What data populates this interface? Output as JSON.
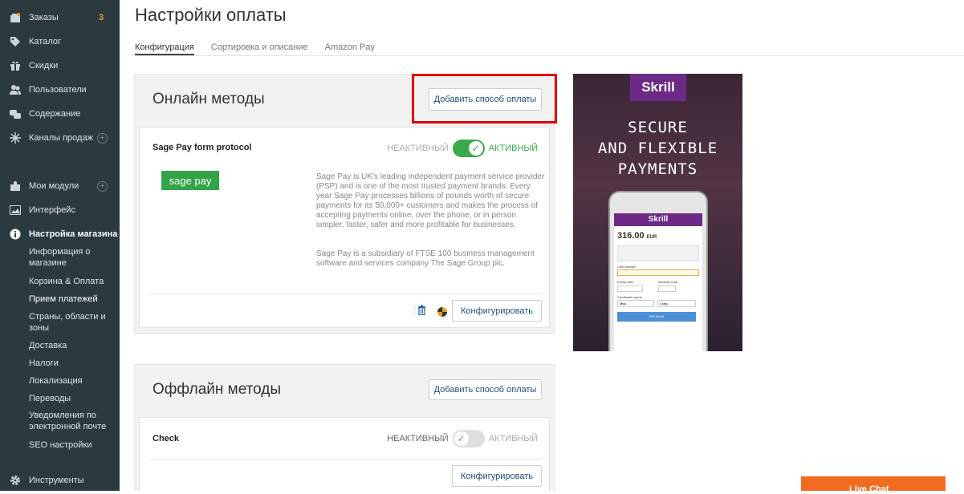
{
  "sidebar": {
    "items": [
      {
        "label": "Заказы",
        "badge": "3"
      },
      {
        "label": "Каталог"
      },
      {
        "label": "Скидки"
      },
      {
        "label": "Пользователи"
      },
      {
        "label": "Содержание"
      },
      {
        "label": "Каналы продаж"
      },
      {
        "label": "Мои модули"
      },
      {
        "label": "Интерфейс"
      },
      {
        "label": "Настройка магазина"
      },
      {
        "label": "Инструменты"
      }
    ],
    "subitems": [
      "Информация о магазине",
      "Корзина & Оплата",
      "Прием платежей",
      "Страны, области и зоны",
      "Доставка",
      "Налоги",
      "Локализация",
      "Переводы",
      "Уведомления по электронной почте",
      "SEO настройки"
    ]
  },
  "page": {
    "title": "Настройки оплаты"
  },
  "tabs": [
    "Конфигурация",
    "Сортировка и описание",
    "Amazon Pay"
  ],
  "online": {
    "title": "Онлайн методы",
    "add_button": "Добавить способ оплаты",
    "method": {
      "name": "Sage Pay form protocol",
      "logo_text": "sage pay",
      "inactive_label": "НЕАКТИВНЫЙ",
      "active_label": "АКТИВНЫЙ",
      "enabled": true,
      "desc1": "Sage Pay is UK's leading independent payment service provider (PSP) and is one of the most trusted payment brands. Every year Sage Pay processes billions of pounds worth of secure payments for its 50,000+ customers and makes the process of accepting payments online, over the phone, or in person simpler, faster, safer and more profitable for businesses.",
      "desc2": "Sage Pay is a subsidiary of FTSE 100 business management software and services company The Sage Group plc.",
      "configure": "Конфигурировать"
    }
  },
  "offline": {
    "title": "Оффлайн методы",
    "add_button": "Добавить способ оплаты",
    "method": {
      "name": "Check",
      "inactive_label": "НЕАКТИВНЫЙ",
      "active_label": "АКТИВНЫЙ",
      "enabled": false,
      "configure": "Конфигурировать"
    }
  },
  "ad": {
    "brand": "Skrill",
    "headline_1": "SECURE",
    "headline_2": "AND FLEXIBLE",
    "headline_3": "PAYMENTS",
    "phone_brand": "Skrill",
    "amount": "316.00",
    "currency": "EUR",
    "card_number_label": "Card number",
    "expiry_label": "Expiry date",
    "security_label": "Security code",
    "holder_label": "Cardholder name",
    "first_name": "Miss",
    "last_name": "Craig",
    "pay_button": "PAY NOW"
  },
  "livechat": {
    "label": "Live Chat"
  },
  "colors": {
    "sidebar": "#2b3a41",
    "accent": "#1d4f7c",
    "toggle_on": "#3aa94a",
    "toggle_off": "#dedede",
    "sagepay": "#32a447",
    "skrill": "#6c2a86",
    "highlight": "#e00000"
  }
}
